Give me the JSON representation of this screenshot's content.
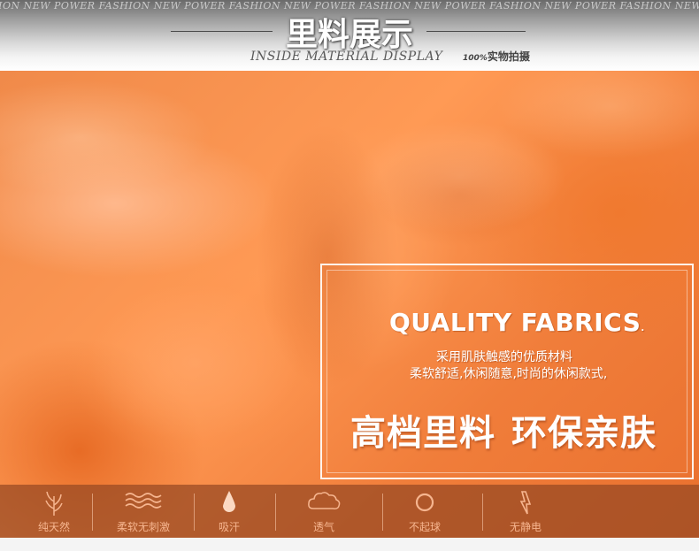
{
  "header": {
    "banner_text": "HION NEW POWER   FASHION NEW POWER   FASHION NEW POWER   FASHION NEW POWER   FASHION NEW POWER   FASHION NEW POWER",
    "title": "里料展示",
    "subtitle": "INSIDE MATERIAL DISPLAY",
    "badge_prefix": "100%",
    "badge_text": "实物拍摄"
  },
  "info": {
    "heading": "QUALITY FABRICS",
    "heading_dot": ".",
    "line1": "采用肌肤触感的优质材料",
    "line2": "柔软舒适,休闲随意,时尚的休闲款式,",
    "slogan_left": "高档里料",
    "slogan_right": "环保亲肤"
  },
  "features": [
    {
      "icon": "wheat-icon",
      "label": "纯天然"
    },
    {
      "icon": "wave-icon",
      "label": "柔软无刺激"
    },
    {
      "icon": "droplet-icon",
      "label": "吸汗"
    },
    {
      "icon": "cloud-icon",
      "label": "透气"
    },
    {
      "icon": "circle-icon",
      "label": "不起球"
    },
    {
      "icon": "lightning-icon",
      "label": "无静电"
    }
  ],
  "colors": {
    "fabric": "#f08a4a",
    "feature_bar": "#96482380",
    "feature_text": "#f6b58f"
  }
}
